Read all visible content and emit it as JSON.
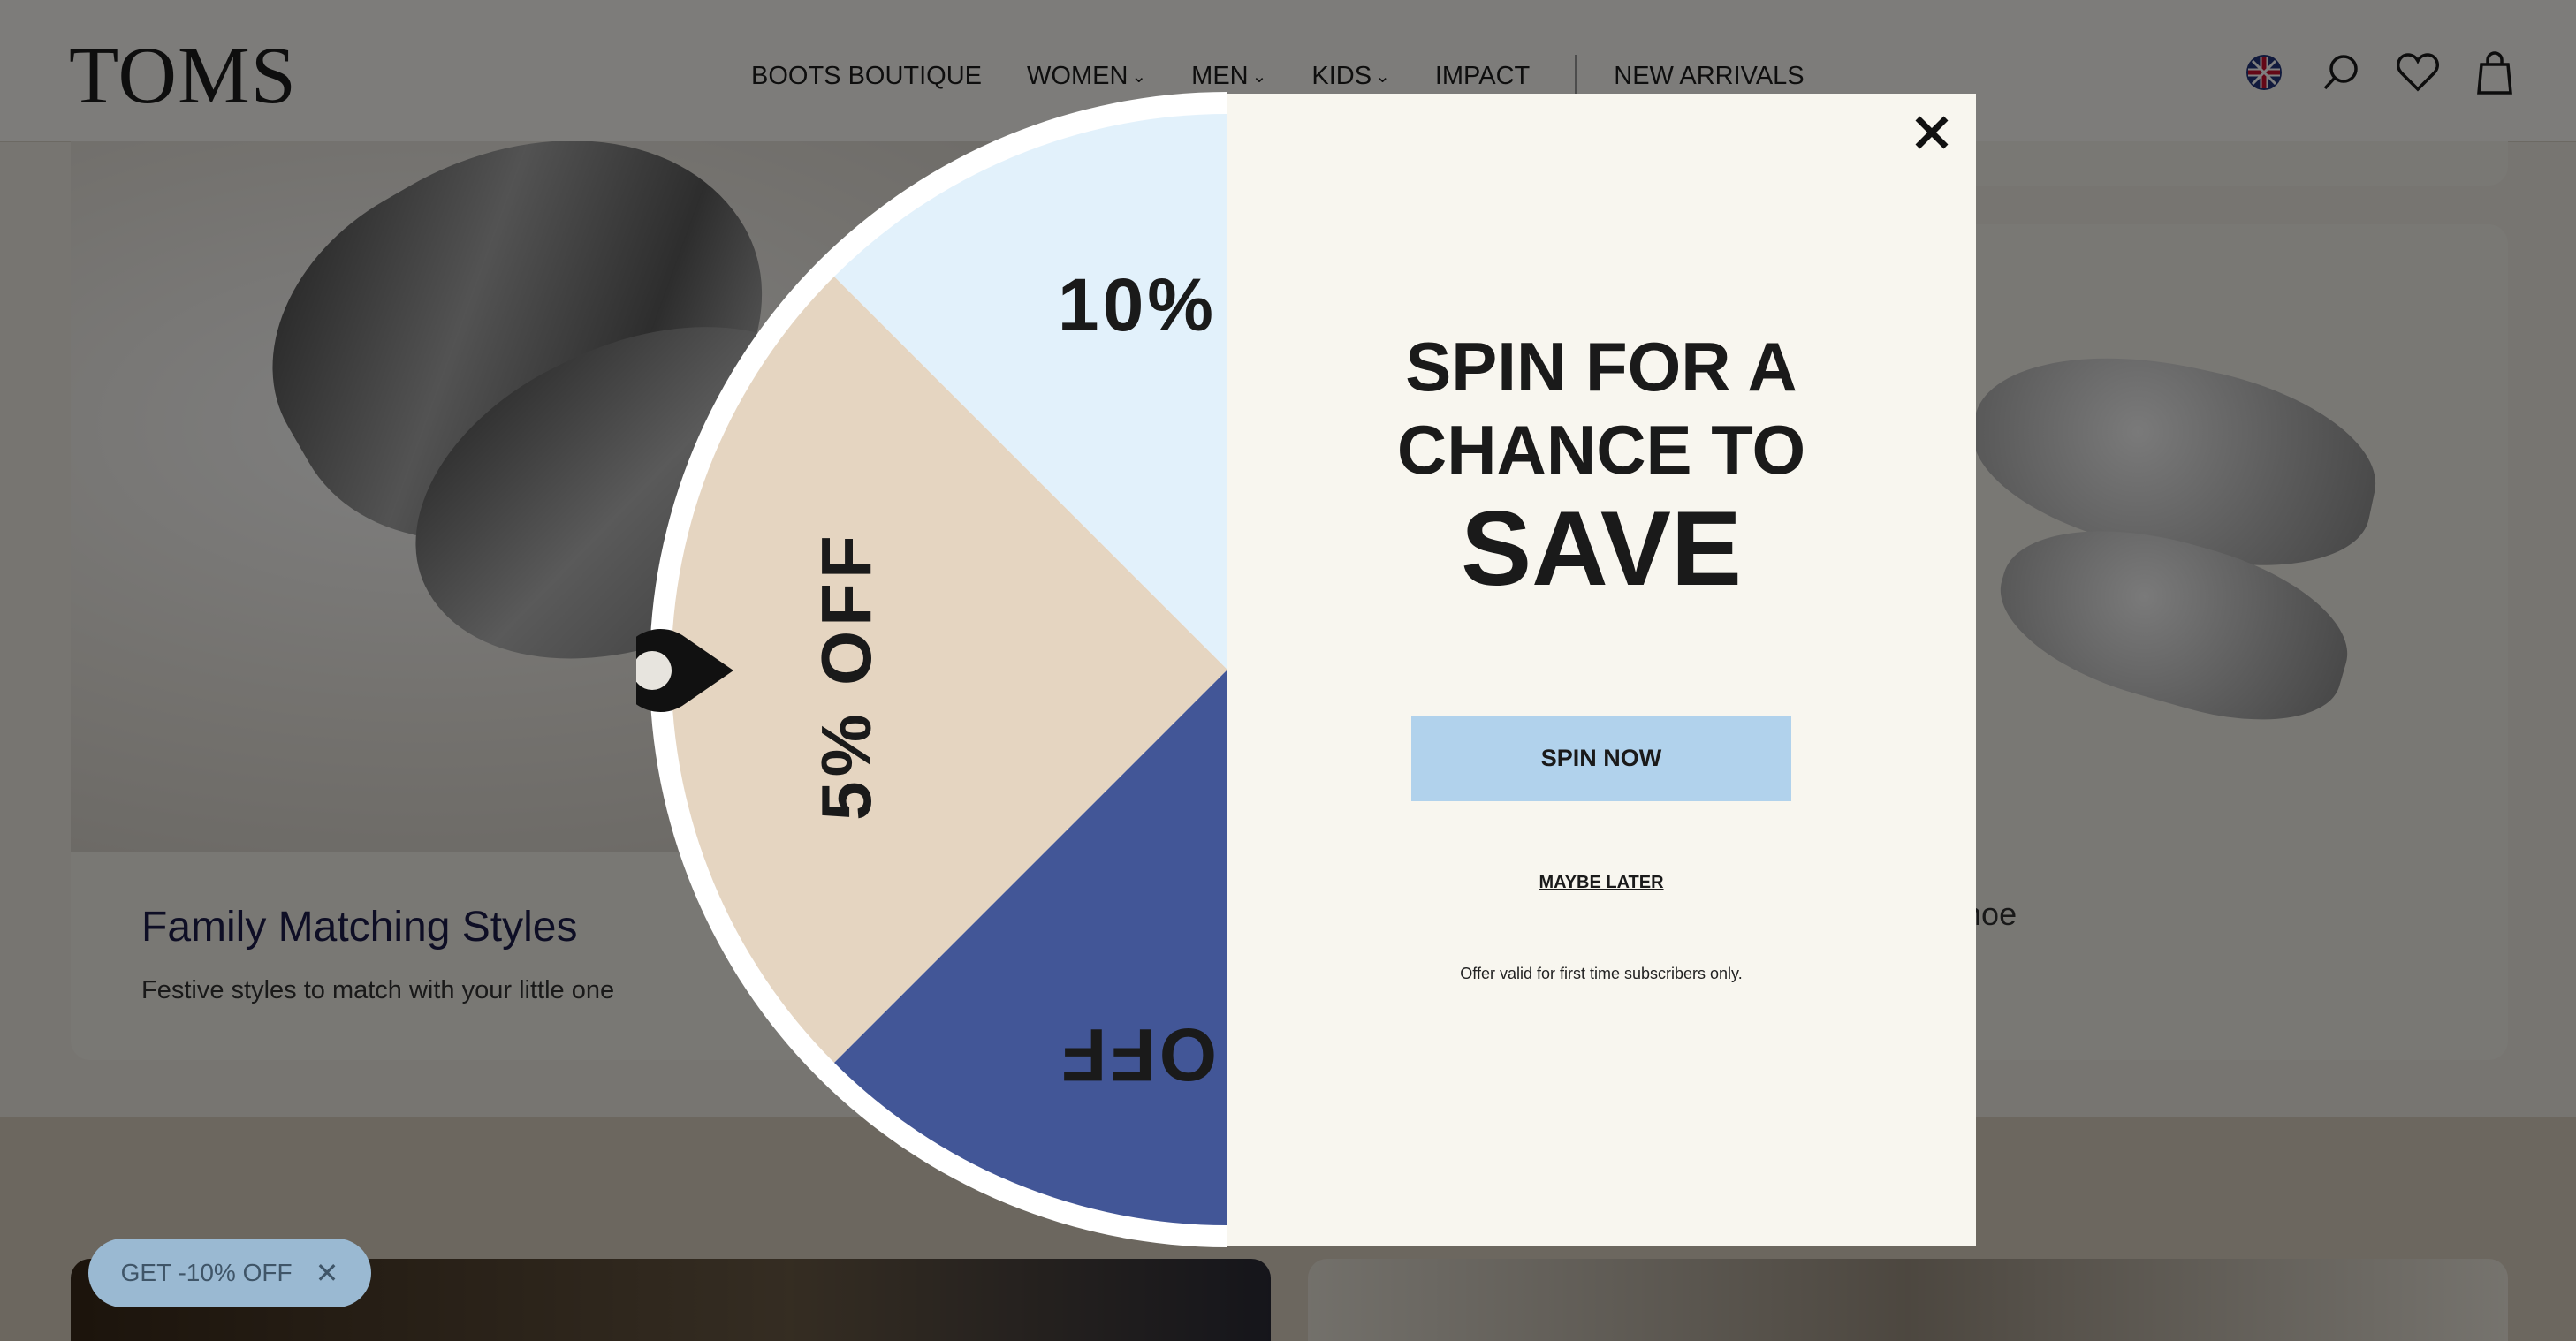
{
  "header": {
    "logo": "TOMS",
    "nav": [
      {
        "label": "BOOTS BOUTIQUE",
        "dropdown": false
      },
      {
        "label": "WOMEN",
        "dropdown": true
      },
      {
        "label": "MEN",
        "dropdown": true
      },
      {
        "label": "KIDS",
        "dropdown": true
      },
      {
        "label": "IMPACT",
        "dropdown": false
      },
      {
        "label": "NEW ARRIVALS",
        "dropdown": false
      }
    ],
    "icons": [
      "uk-flag-icon",
      "search-icon",
      "heart-icon",
      "bag-icon"
    ]
  },
  "cards": [
    {
      "title": "Family Matching Styles",
      "subtitle": "Festive styles to match with your little one"
    },
    {
      "title_partial": "ller Shoe"
    }
  ],
  "badge": {
    "label": "GET -10% OFF",
    "close": "✕"
  },
  "wheel": {
    "segments": [
      "10%",
      "5% OFF",
      "OFF"
    ],
    "colors": {
      "top": "#e2f1fb",
      "left": "#e5d5c1",
      "bottom": "#425697",
      "rim": "#ffffff"
    }
  },
  "popup": {
    "heading_line1": "SPIN FOR A",
    "heading_line2": "CHANCE TO",
    "heading_line3": "SAVE",
    "spin_button": "SPIN NOW",
    "maybe_later": "MAYBE LATER",
    "terms": "Offer valid for first time subscribers only.",
    "close": "✕",
    "accent": "#b1d2ec"
  }
}
